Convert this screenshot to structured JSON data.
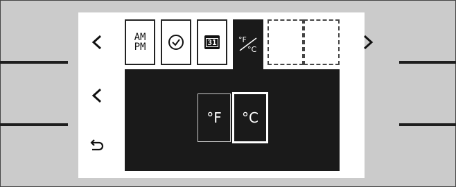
{
  "tabs": [
    {
      "label": "AM\nPM",
      "icon": "am-pm-icon"
    },
    {
      "icon": "clock-icon"
    },
    {
      "label": "31",
      "icon": "calendar-icon"
    },
    {
      "label": "°F/°C",
      "icon": "temperature-unit-icon"
    },
    {
      "icon": "empty-slot"
    },
    {
      "icon": "empty-slot"
    }
  ],
  "nav": {
    "prev_tab": "‹",
    "next_tab": "›",
    "back_level": "‹",
    "return": "↩"
  },
  "units": {
    "fahrenheit": "°F",
    "celsius": "°C",
    "selected": "°C"
  },
  "colors": {
    "panel_bg": "#ffffff",
    "screen_bg": "#1a1a1a",
    "housing": "#cbcbcb"
  }
}
